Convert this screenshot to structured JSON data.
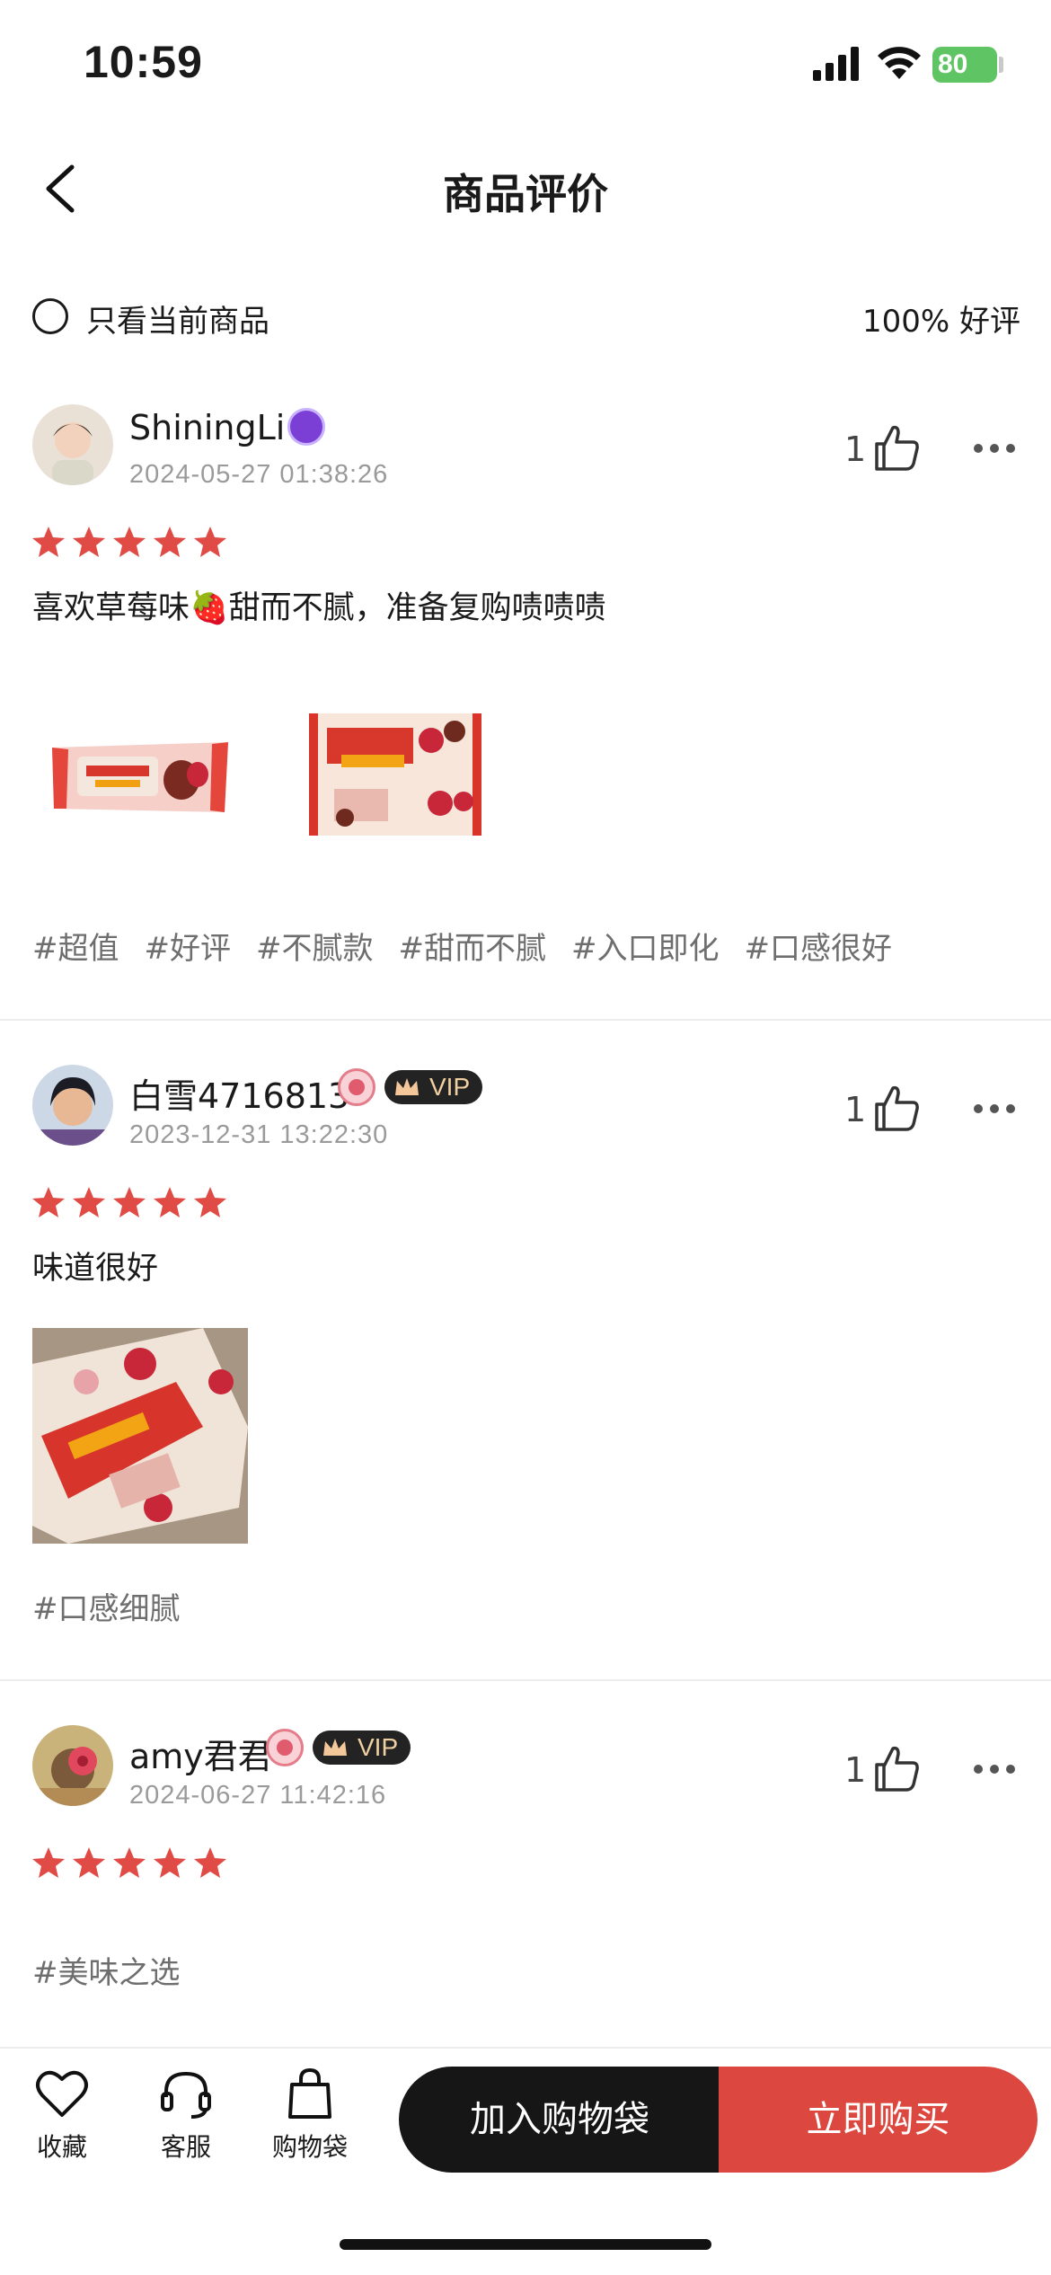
{
  "status_bar": {
    "time": "10:59",
    "battery": "80"
  },
  "nav": {
    "title": "商品评价"
  },
  "filter": {
    "label": "只看当前商品",
    "praise_rate": "100% 好评"
  },
  "reviews": [
    {
      "username": "ShiningLi",
      "date": "2024-05-27 01:38:26",
      "likes": "1",
      "rating": 5,
      "text": "喜欢草莓味🍓甜而不腻，准备复购啧啧啧",
      "tags": [
        "#超值",
        "#好评",
        "#不腻款",
        "#甜而不腻",
        "#入口即化",
        "#口感很好"
      ]
    },
    {
      "username": "白雪4716813",
      "vip": "VIP",
      "date": "2023-12-31 13:22:30",
      "likes": "1",
      "rating": 5,
      "text": "味道很好",
      "tags": [
        "#口感细腻"
      ]
    },
    {
      "username": "amy君君",
      "vip": "VIP",
      "date": "2024-06-27 11:42:16",
      "likes": "1",
      "rating": 5,
      "text": "",
      "tags": [
        "#美味之选"
      ]
    }
  ],
  "bottom_bar": {
    "favorite": "收藏",
    "service": "客服",
    "bag": "购物袋",
    "add_to_bag": "加入购物袋",
    "buy_now": "立即购买"
  },
  "colors": {
    "accent_red": "#dc4840",
    "star_red": "#e04b45",
    "black_button": "#161616"
  },
  "icons": [
    "back-icon",
    "like-icon",
    "more-icon",
    "heart-icon",
    "headset-icon",
    "bag-icon"
  ]
}
